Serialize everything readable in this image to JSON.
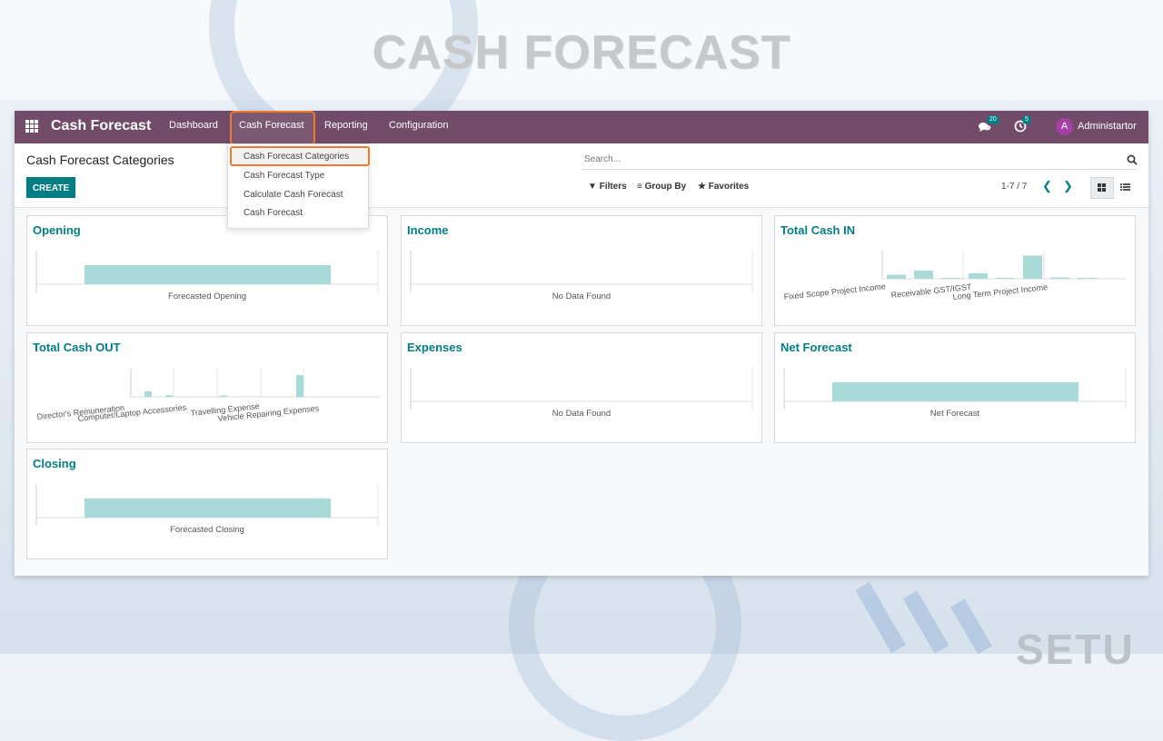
{
  "banner": "CASH FORECAST",
  "watermark": "SETU",
  "navbar": {
    "brand": "Cash Forecast",
    "menu": [
      "Dashboard",
      "Cash Forecast",
      "Reporting",
      "Configuration"
    ],
    "messages_count": "20",
    "activities_count": "5",
    "avatar_letter": "A",
    "user": "Administartor"
  },
  "dropdown": {
    "items": [
      "Cash Forecast Categories",
      "Cash Forecast Type",
      "Calculate Cash Forecast",
      "Cash Forecast"
    ]
  },
  "control": {
    "title": "Cash Forecast Categories",
    "create": "CREATE",
    "search_placeholder": "Search...",
    "filters": "Filters",
    "group_by": "Group By",
    "favorites": "Favorites",
    "pager": "1-7 / 7"
  },
  "colors": {
    "navbar": "#714b67",
    "accent": "#017e84",
    "bar": "#a8dbd7",
    "highlight": "#f07a2a"
  },
  "cards": {
    "opening": {
      "title": "Opening",
      "label": "Forecasted Opening"
    },
    "income": {
      "title": "Income",
      "label": "No Data Found"
    },
    "total_in": {
      "title": "Total Cash IN"
    },
    "total_out": {
      "title": "Total Cash OUT"
    },
    "expenses": {
      "title": "Expenses",
      "label": "No Data Found"
    },
    "net": {
      "title": "Net Forecast",
      "label": "Net Forecast"
    },
    "closing": {
      "title": "Closing",
      "label": "Forecasted Closing"
    }
  },
  "chart_data": [
    {
      "type": "bar",
      "categories": [
        "Forecasted Opening"
      ],
      "values": [
        1
      ]
    },
    {
      "type": "bar",
      "categories": [
        "Fixed Scope Project Income",
        "Receivable GST/IGST",
        "Long Term Project Income"
      ],
      "values": [
        0.15,
        0.3,
        0.03,
        0.2,
        0.02,
        0.85,
        0.05,
        0.02
      ]
    },
    {
      "type": "bar",
      "categories": [
        "Director's Remuneration",
        "Computer/Laptop Accessories",
        "Travelling Expense",
        "Vehicle Repairing Expenses"
      ],
      "values": [
        0.2,
        0.06,
        0.05,
        0.8
      ]
    },
    {
      "type": "bar",
      "categories": [
        "Net Forecast"
      ],
      "values": [
        1
      ]
    },
    {
      "type": "bar",
      "categories": [
        "Forecasted Closing"
      ],
      "values": [
        1
      ]
    }
  ]
}
